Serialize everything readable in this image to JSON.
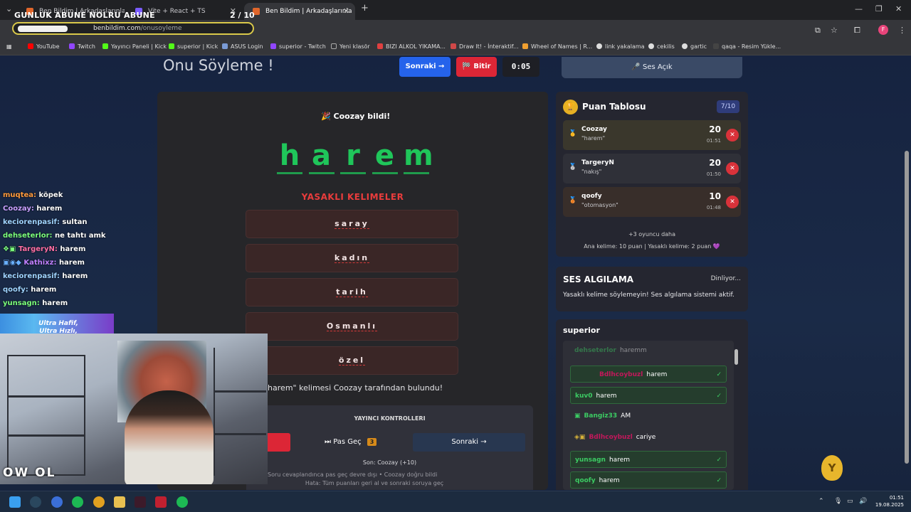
{
  "browser": {
    "overlay_title": "GUNLUK ABUNE NOLRU ABUNE",
    "overlay_count": "2  / 10",
    "tabs": [
      {
        "label": "Ben Bildim | Arkadaşlarınla On",
        "active": false
      },
      {
        "label": "Vite + React + TS",
        "active": false
      },
      {
        "label": "Ben Bildim | Arkadaşlarınla",
        "active": true
      }
    ],
    "new_tab": "+",
    "url_domain": "benbildim.com",
    "url_path": "/onusoyleme",
    "bookmarks": [
      {
        "label": "YouTube",
        "color": "#ff0000"
      },
      {
        "label": "Twitch",
        "color": "#9146ff"
      },
      {
        "label": "Yayıncı Paneli | Kick",
        "color": "#53fc18"
      },
      {
        "label": "superior | Kick",
        "color": "#53fc18"
      },
      {
        "label": "ASUS Login",
        "color": "#7a9bd6"
      },
      {
        "label": "superior - Twitch",
        "color": "#9146ff"
      },
      {
        "label": "Yeni klasör",
        "color": "#777777"
      },
      {
        "label": "BIZI ALKOL YIKAMA...",
        "color": "#e04040"
      },
      {
        "label": "Draw It! - İnteraktif...",
        "color": "#d04848"
      },
      {
        "label": "Wheel of Names | R...",
        "color": "#f0a030"
      },
      {
        "label": "link yakalama",
        "color": "#dddddd"
      },
      {
        "label": "cekilis",
        "color": "#dddddd"
      },
      {
        "label": "gartic",
        "color": "#dddddd"
      },
      {
        "label": "qaqa - Resim Yükle...",
        "color": "#444444"
      }
    ]
  },
  "game": {
    "title": "Onu Söyleme !",
    "next_label": "Sonraki →",
    "finish_label": "Bitir",
    "timer": "0:05",
    "sound_toggle": "Ses Açık",
    "guessed_banner": "Coozay bildi!",
    "letters": [
      "h",
      "a",
      "r",
      "e",
      "m"
    ],
    "forbidden_title": "YASAKLI KELIMELER",
    "forbidden_words": [
      "saray",
      "kadın",
      "tarih",
      "Osmanlı",
      "özel"
    ],
    "found_message": "\"harem\" kelimesi Coozay tarafından bulundu!",
    "controls": {
      "title": "YAYINCI KONTROLLERI",
      "pass_label": "Pas Geç",
      "pass_count": "3",
      "next_label": "Sonraki →",
      "last": "Son: Coozay (+10)",
      "help1": "Soru cevaplandınca pas geç devre dışı • Coozay doğru bildi",
      "help2": "Hata: Tüm puanları geri al ve sonraki soruya geç"
    }
  },
  "scoreboard": {
    "title": "Puan Tablosu",
    "round": "7/10",
    "players": [
      {
        "name": "Coozay",
        "guess": "\"harem\"",
        "score": "20",
        "time": "01:51",
        "medal": "🥇",
        "bg": "#3a372c"
      },
      {
        "name": "TargeryN",
        "guess": "\"nakış\"",
        "score": "20",
        "time": "01:50",
        "medal": "🥈",
        "bg": "#2f3038"
      },
      {
        "name": "qoofy",
        "guess": "\"otomasyon\"",
        "score": "10",
        "time": "01:48",
        "medal": "🥉",
        "bg": "#382e2a"
      }
    ],
    "more": "+3 oyuncu daha",
    "rules": "Ana kelime: 10 puan | Yasaklı kelime: 2 puan 💜"
  },
  "sound_detect": {
    "title": "SES ALGILAMA",
    "state": "Dinliyor...",
    "desc": "Yasaklı kelime söylemeyin! Ses algılama sistemi aktif."
  },
  "chat": {
    "title": "superior",
    "messages": [
      {
        "user": "dehseterlor",
        "text": "haremm",
        "color": "#3ccb63",
        "ok": false,
        "faded": true
      },
      {
        "user": "Bdlhcoybuzl",
        "text": "harem",
        "color": "#c2185b",
        "ok": true,
        "faded": false
      },
      {
        "user": "kuv0",
        "text": "harem",
        "color": "#3ccb63",
        "ok": true,
        "faded": false
      },
      {
        "user": "Bangiz33",
        "text": "AM",
        "color": "#3ccb63",
        "ok": false,
        "faded": false
      },
      {
        "user": "Bdlhcoybuzl",
        "text": "cariye",
        "color": "#c2185b",
        "ok": false,
        "faded": false
      },
      {
        "user": "yunsagn",
        "text": "harem",
        "color": "#3ccb63",
        "ok": true,
        "faded": false
      },
      {
        "user": "qoofy",
        "text": "harem",
        "color": "#3ccb63",
        "ok": true,
        "faded": false
      }
    ]
  },
  "stream_chat": [
    {
      "user": "muqtea:",
      "text": "köpek",
      "color": "#ff9a3c"
    },
    {
      "user": "Coozay:",
      "text": "harem",
      "color": "#c9a0ff"
    },
    {
      "user": "keciorenpasif:",
      "text": "sultan",
      "color": "#a0d4ff"
    },
    {
      "user": "dehseterlor:",
      "text": "ne tahtı amk",
      "color": "#7cff7c"
    },
    {
      "user": "TargeryN:",
      "text": "harem",
      "color": "#ff6fa5"
    },
    {
      "user": "Kathixz:",
      "text": "harem",
      "color": "#c080ff"
    },
    {
      "user": "keciorenpasif:",
      "text": "harem",
      "color": "#a0d4ff"
    },
    {
      "user": "qoofy:",
      "text": "harem",
      "color": "#a0d4ff"
    },
    {
      "user": "yunsagn:",
      "text": "harem",
      "color": "#7cff7c"
    }
  ],
  "stream_overlay": {
    "ad_text": "Ultra Hafif, Ultra Hızlı, Ultra Hassas!",
    "cam_label": "OW OL"
  },
  "taskbar": {
    "time": "01:51",
    "date": "19.08.2025"
  }
}
